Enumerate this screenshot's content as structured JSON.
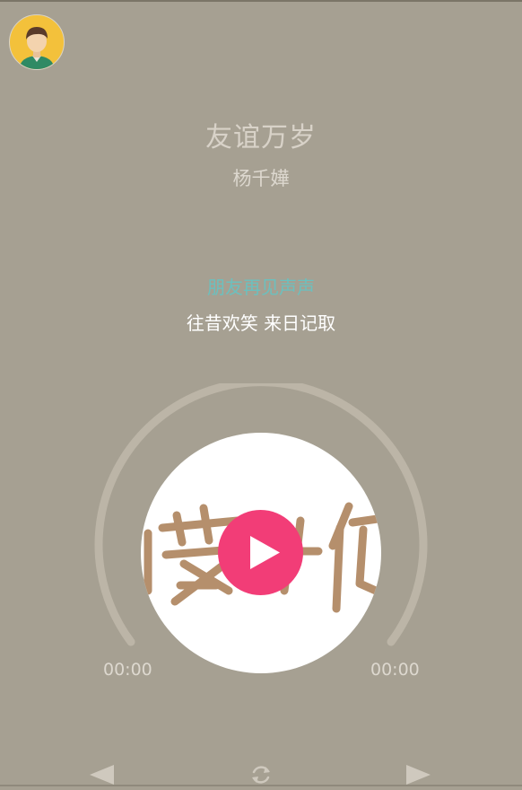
{
  "song": {
    "title": "友谊万岁",
    "artist": "杨千嬅"
  },
  "lyrics": {
    "current": "朋友再见声声",
    "next": "往昔欢笑 来日记取"
  },
  "player": {
    "elapsed": "00:00",
    "duration": "00:00",
    "progress": 0,
    "state": "paused"
  },
  "icons": {
    "avatar": "user-avatar-icon",
    "play": "play-icon",
    "prev": "previous-icon",
    "loop": "repeat-icon",
    "next": "next-icon"
  },
  "colors": {
    "background": "#a6a092",
    "play_button": "#f23d77",
    "current_lyric": "#6cc0be",
    "title_text": "#d8d2c8"
  }
}
